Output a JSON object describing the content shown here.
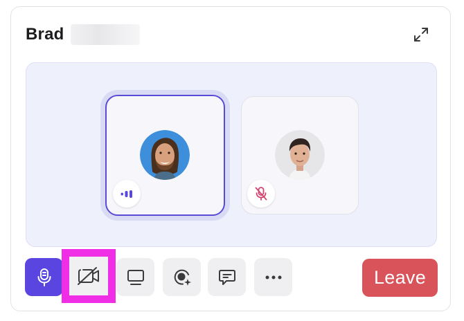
{
  "call": {
    "title": "Brad"
  },
  "participants": [
    {
      "speaking": true,
      "muted": false
    },
    {
      "speaking": false,
      "muted": true
    }
  ],
  "controls": {
    "leave_label": "Leave"
  },
  "colors": {
    "accent": "#5b45e0",
    "active_border": "#5a4bd6",
    "leave": "#d9535a",
    "muted_icon": "#d2446e",
    "highlight": "#f02ee6"
  },
  "icons": [
    "expand-icon",
    "speaking-indicator-icon",
    "mic-off-icon",
    "mic-icon",
    "camera-off-icon",
    "screen-share-icon",
    "effects-icon",
    "chat-icon",
    "more-icon"
  ]
}
